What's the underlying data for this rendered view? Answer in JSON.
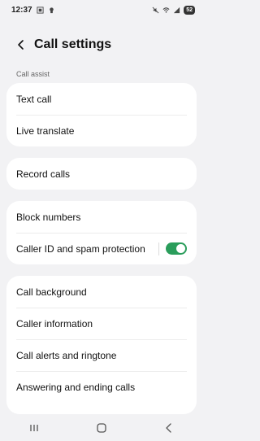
{
  "status_bar": {
    "time": "12:37",
    "battery": "52",
    "icons": [
      "screenshot-icon",
      "notification-icon",
      "mute-icon",
      "wifi-icon",
      "signal-icon",
      "battery-icon"
    ]
  },
  "header": {
    "title": "Call settings",
    "back_icon": "back-arrow-icon"
  },
  "sections": {
    "call_assist_label": "Call assist"
  },
  "cards": {
    "assist": [
      "Text call",
      "Live translate"
    ],
    "record": [
      "Record calls"
    ],
    "block": {
      "block_numbers": "Block numbers",
      "caller_id": "Caller ID and spam protection",
      "caller_id_enabled": true
    },
    "misc": [
      "Call background",
      "Caller information",
      "Call alerts and ringtone",
      "Answering and ending calls"
    ]
  },
  "colors": {
    "accent": "#2a9d5b",
    "background": "#f2f2f4",
    "card": "#ffffff"
  },
  "nav_bar": {
    "icons": [
      "recent-apps-icon",
      "home-icon",
      "back-icon"
    ]
  }
}
